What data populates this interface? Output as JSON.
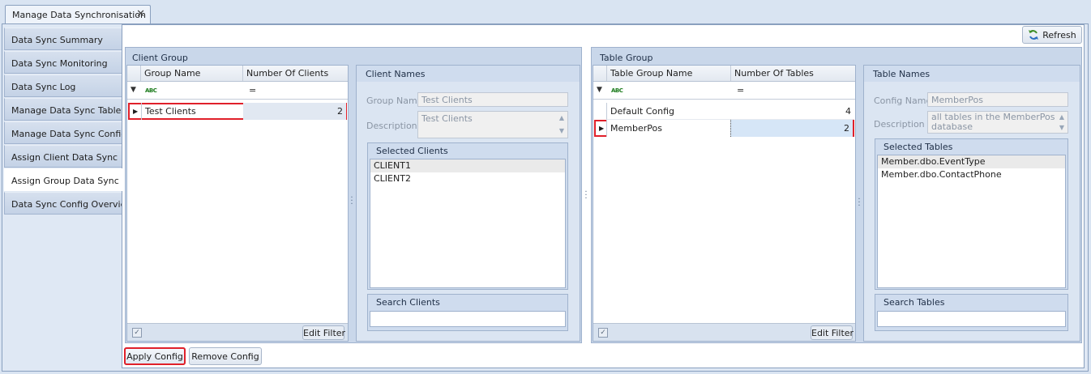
{
  "window": {
    "tab_title": "Manage Data Synchronisation",
    "tab_close": "✕"
  },
  "sidebar": {
    "items": [
      {
        "label": "Data Sync Summary"
      },
      {
        "label": "Data Sync Monitoring"
      },
      {
        "label": "Data Sync Log"
      },
      {
        "label": "Manage Data Sync Tables"
      },
      {
        "label": "Manage Data Sync Configs"
      },
      {
        "label": "Assign Client Data Sync"
      },
      {
        "label": "Assign Group Data Sync"
      },
      {
        "label": "Data Sync Config Overview"
      }
    ],
    "active_index": 6
  },
  "toolbar": {
    "refresh_label": "Refresh",
    "refresh_icon": "refresh-icon"
  },
  "client_group": {
    "title": "Client Group",
    "columns": [
      "Group Name",
      "Number Of Clients"
    ],
    "filter_abc": "ABC",
    "filter_eq": "=",
    "rows": [
      {
        "name": "Test Clients",
        "count": "2",
        "selected": true
      }
    ],
    "edit_filter_label": "Edit Filter",
    "filter_checkbox": "✓"
  },
  "client_names": {
    "title": "Client Names",
    "group_name_label": "Group Name",
    "group_name_value": "Test Clients",
    "description_label": "Description",
    "description_value": "Test Clients",
    "selected_title": "Selected Clients",
    "selected_items": [
      "CLIENT1",
      "CLIENT2"
    ],
    "search_title": "Search Clients",
    "search_value": ""
  },
  "table_group": {
    "title": "Table Group",
    "columns": [
      "Table Group Name",
      "Number Of Tables"
    ],
    "filter_abc": "ABC",
    "filter_eq": "=",
    "rows": [
      {
        "name": "Default Config",
        "count": "4",
        "selected": false
      },
      {
        "name": "MemberPos",
        "count": "2",
        "selected": true
      }
    ],
    "edit_filter_label": "Edit Filter",
    "filter_checkbox": "✓"
  },
  "table_names": {
    "title": "Table Names",
    "config_name_label": "Config Name",
    "config_name_value": "MemberPos",
    "description_label": "Description",
    "description_line1": "all tables in the MemberPos",
    "description_line2": "database",
    "selected_title": "Selected Tables",
    "selected_items": [
      "Member.dbo.EventType",
      "Member.dbo.ContactPhone"
    ],
    "search_title": "Search Tables",
    "search_value": ""
  },
  "actions": {
    "apply_label": "Apply Config",
    "remove_label": "Remove Config"
  },
  "colors": {
    "highlight": "#e0202a",
    "selected_row": "#d6e6f7"
  }
}
